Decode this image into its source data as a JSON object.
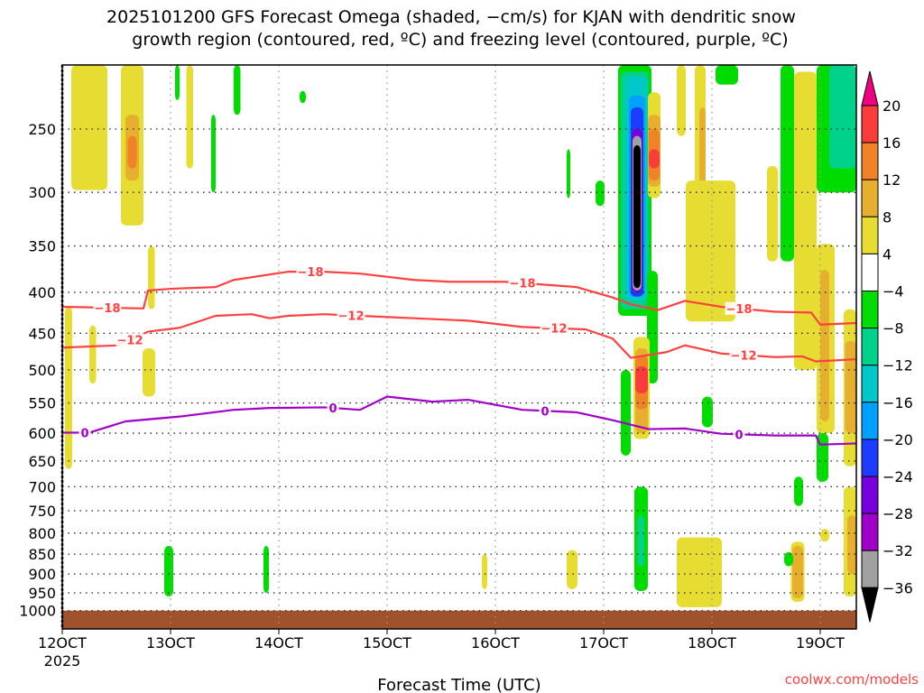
{
  "chart_data": {
    "type": "heatmap",
    "title_line1": "2025101200 GFS Forecast Omega (shaded, −cm/s) for KJAN with dendritic snow",
    "title_line2": "growth region (contoured, red, ºC) and freezing level (contoured, purple, ºC)",
    "xlabel": "Forecast Time (UTC)",
    "credit": "coolwx.com/models",
    "x_unit": "hours since 2025-10-12 00Z",
    "xlim": [
      0,
      176
    ],
    "ylim_hPa": [
      208,
      1053
    ],
    "y_scale": "log, inverted",
    "x_ticks": [
      {
        "hour": 0,
        "label": "12OCT",
        "sublabel": "2025"
      },
      {
        "hour": 24,
        "label": "13OCT"
      },
      {
        "hour": 48,
        "label": "14OCT"
      },
      {
        "hour": 72,
        "label": "15OCT"
      },
      {
        "hour": 96,
        "label": "16OCT"
      },
      {
        "hour": 120,
        "label": "17OCT"
      },
      {
        "hour": 144,
        "label": "18OCT"
      },
      {
        "hour": 168,
        "label": "19OCT"
      }
    ],
    "y_ticks": [
      250,
      300,
      350,
      400,
      450,
      500,
      550,
      600,
      650,
      700,
      750,
      800,
      850,
      900,
      950,
      1000
    ],
    "grid": true,
    "colorbar": {
      "position": "right",
      "labels": [
        "20",
        "16",
        "12",
        "8",
        "4",
        "−4",
        "−8",
        "−12",
        "−16",
        "−20",
        "−24",
        "−28",
        "−32",
        "−36"
      ],
      "bins": [
        {
          "min": 16,
          "max": 20,
          "color": "#fa3c3c"
        },
        {
          "min": 12,
          "max": 16,
          "color": "#f08228"
        },
        {
          "min": 8,
          "max": 12,
          "color": "#e6af2d"
        },
        {
          "min": 4,
          "max": 8,
          "color": "#e6dc32"
        },
        {
          "min": -4,
          "max": 4,
          "color": "#ffffff"
        },
        {
          "min": -8,
          "max": -4,
          "color": "#00dc00"
        },
        {
          "min": -12,
          "max": -8,
          "color": "#00d28c"
        },
        {
          "min": -16,
          "max": -12,
          "color": "#00c8c8"
        },
        {
          "min": -20,
          "max": -16,
          "color": "#00a0ff"
        },
        {
          "min": -24,
          "max": -20,
          "color": "#1e3cff"
        },
        {
          "min": -28,
          "max": -24,
          "color": "#7800dc"
        },
        {
          "min": -32,
          "max": -28,
          "color": "#a000c8"
        },
        {
          "min": -36,
          "max": -32,
          "color": "#a0a0a0"
        }
      ],
      "over_color": "#f00082",
      "under_color": "#000000"
    },
    "ground_color": "#a0522d",
    "ground_top_hPa": 1000,
    "shaded_regions": [
      {
        "t": [
          2,
          10
        ],
        "p": [
          208,
          298
        ],
        "v": 6
      },
      {
        "t": [
          13,
          18
        ],
        "p": [
          208,
          330
        ],
        "v": 6
      },
      {
        "t": [
          14,
          17
        ],
        "p": [
          240,
          290
        ],
        "v": 10
      },
      {
        "t": [
          14.5,
          16.5
        ],
        "p": [
          255,
          280
        ],
        "v": 14
      },
      {
        "t": [
          0.6,
          2.2
        ],
        "p": [
          417,
          665
        ],
        "v": 6
      },
      {
        "t": [
          6,
          7.5
        ],
        "p": [
          440,
          520
        ],
        "v": 6
      },
      {
        "t": [
          17.8,
          20.6
        ],
        "p": [
          470,
          540
        ],
        "v": 6
      },
      {
        "t": [
          19,
          20.5
        ],
        "p": [
          350,
          420
        ],
        "v": 6
      },
      {
        "t": [
          22.6,
          24.6
        ],
        "p": [
          830,
          960
        ],
        "v": -6
      },
      {
        "t": [
          44.6,
          45.8
        ],
        "p": [
          830,
          950
        ],
        "v": -6
      },
      {
        "t": [
          33,
          34
        ],
        "p": [
          240,
          300
        ],
        "v": -6
      },
      {
        "t": [
          25,
          26
        ],
        "p": [
          208,
          230
        ],
        "v": -6
      },
      {
        "t": [
          27.5,
          29
        ],
        "p": [
          208,
          280
        ],
        "v": 6
      },
      {
        "t": [
          38,
          39.5
        ],
        "p": [
          208,
          240
        ],
        "v": -6
      },
      {
        "t": [
          52.6,
          54
        ],
        "p": [
          224,
          232
        ],
        "v": -6
      },
      {
        "t": [
          93,
          94.2
        ],
        "p": [
          850,
          940
        ],
        "v": 6
      },
      {
        "t": [
          111.8,
          114.2
        ],
        "p": [
          840,
          940
        ],
        "v": 6
      },
      {
        "t": [
          111.8,
          112.6
        ],
        "p": [
          265,
          305
        ],
        "v": -6
      },
      {
        "t": [
          118.2,
          120.2
        ],
        "p": [
          290,
          312
        ],
        "v": -6
      },
      {
        "t": [
          123.2,
          130.6
        ],
        "p": [
          208,
          428
        ],
        "v": -6
      },
      {
        "t": [
          123.8,
          130
        ],
        "p": [
          212,
          420
        ],
        "v": -10
      },
      {
        "t": [
          124.8,
          129.6
        ],
        "p": [
          215,
          410
        ],
        "v": -14
      },
      {
        "t": [
          125.6,
          129.2
        ],
        "p": [
          227,
          405
        ],
        "v": -18
      },
      {
        "t": [
          126,
          128.8
        ],
        "p": [
          235,
          405
        ],
        "v": -22
      },
      {
        "t": [
          126.2,
          128.6
        ],
        "p": [
          250,
          400
        ],
        "v": -26
      },
      {
        "t": [
          126.4,
          128.4
        ],
        "p": [
          255,
          398
        ],
        "v": -34
      },
      {
        "t": [
          126.6,
          128.2
        ],
        "p": [
          262,
          395
        ],
        "v": -40
      },
      {
        "t": [
          129.8,
          132.6
        ],
        "p": [
          225,
          305
        ],
        "v": 6
      },
      {
        "t": [
          129.8,
          132.6
        ],
        "p": [
          240,
          295
        ],
        "v": 10
      },
      {
        "t": [
          130,
          132.4
        ],
        "p": [
          250,
          290
        ],
        "v": 14
      },
      {
        "t": [
          130,
          132.4
        ],
        "p": [
          265,
          280
        ],
        "v": 18
      },
      {
        "t": [
          129.6,
          132
        ],
        "p": [
          376,
          520
        ],
        "v": -6
      },
      {
        "t": [
          126.6,
          130.2
        ],
        "p": [
          455,
          610
        ],
        "v": 6
      },
      {
        "t": [
          127,
          129.8
        ],
        "p": [
          470,
          600
        ],
        "v": 10
      },
      {
        "t": [
          127,
          129.8
        ],
        "p": [
          480,
          560
        ],
        "v": 14
      },
      {
        "t": [
          127,
          129.8
        ],
        "p": [
          495,
          535
        ],
        "v": 18
      },
      {
        "t": [
          123.8,
          126
        ],
        "p": [
          500,
          640
        ],
        "v": -6
      },
      {
        "t": [
          126.8,
          129.8
        ],
        "p": [
          700,
          945
        ],
        "v": -6
      },
      {
        "t": [
          127.5,
          129
        ],
        "p": [
          760,
          880
        ],
        "v": -10
      },
      {
        "t": [
          136.2,
          138.2
        ],
        "p": [
          208,
          255
        ],
        "v": 6
      },
      {
        "t": [
          140.2,
          142.6
        ],
        "p": [
          208,
          298
        ],
        "v": 6
      },
      {
        "t": [
          141.2,
          142.6
        ],
        "p": [
          235,
          295
        ],
        "v": 10
      },
      {
        "t": [
          138.2,
          149.2
        ],
        "p": [
          290,
          435
        ],
        "v": 6
      },
      {
        "t": [
          141.8,
          144.2
        ],
        "p": [
          540,
          590
        ],
        "v": -6
      },
      {
        "t": [
          136.2,
          146.2
        ],
        "p": [
          810,
          990
        ],
        "v": 6
      },
      {
        "t": [
          144.8,
          149.8
        ],
        "p": [
          208,
          220
        ],
        "v": -6
      },
      {
        "t": [
          156.2,
          158.6
        ],
        "p": [
          278,
          366
        ],
        "v": 6
      },
      {
        "t": [
          159.2,
          162.2
        ],
        "p": [
          208,
          366
        ],
        "v": -6
      },
      {
        "t": [
          162.2,
          167.2
        ],
        "p": [
          212,
          500
        ],
        "v": 6
      },
      {
        "t": [
          167.2,
          176
        ],
        "p": [
          208,
          300
        ],
        "v": -6
      },
      {
        "t": [
          170,
          176
        ],
        "p": [
          208,
          280
        ],
        "v": -10
      },
      {
        "t": [
          167.2,
          171.2
        ],
        "p": [
          348,
          600
        ],
        "v": 6
      },
      {
        "t": [
          168,
          170
        ],
        "p": [
          375,
          580
        ],
        "v": 10
      },
      {
        "t": [
          173.2,
          176
        ],
        "p": [
          420,
          660
        ],
        "v": 6
      },
      {
        "t": [
          173.5,
          176
        ],
        "p": [
          460,
          600
        ],
        "v": 10
      },
      {
        "t": [
          173.2,
          176
        ],
        "p": [
          700,
          960
        ],
        "v": 6
      },
      {
        "t": [
          174,
          176
        ],
        "p": [
          760,
          900
        ],
        "v": 10
      },
      {
        "t": [
          161.5,
          164.5
        ],
        "p": [
          820,
          975
        ],
        "v": 6
      },
      {
        "t": [
          161.8,
          164.2
        ],
        "p": [
          830,
          965
        ],
        "v": 10
      },
      {
        "t": [
          167.2,
          169.8
        ],
        "p": [
          600,
          690
        ],
        "v": -6
      },
      {
        "t": [
          162.2,
          164.2
        ],
        "p": [
          680,
          740
        ],
        "v": -6
      },
      {
        "t": [
          160,
          162
        ],
        "p": [
          845,
          880
        ],
        "v": -6
      },
      {
        "t": [
          168,
          170
        ],
        "p": [
          790,
          820
        ],
        "v": 6
      }
    ],
    "contours": [
      {
        "name": "dgz-minus18",
        "label": "−18",
        "color": "#ff4040",
        "points": [
          [
            0,
            417
          ],
          [
            18,
            419
          ],
          [
            19,
            398
          ],
          [
            24,
            396
          ],
          [
            34,
            394
          ],
          [
            38,
            386
          ],
          [
            46,
            380
          ],
          [
            50,
            377
          ],
          [
            58,
            377
          ],
          [
            66,
            379
          ],
          [
            78,
            386
          ],
          [
            86,
            388
          ],
          [
            98,
            388
          ],
          [
            114,
            394
          ],
          [
            122,
            406
          ],
          [
            126,
            414
          ],
          [
            132,
            421
          ],
          [
            138,
            410
          ],
          [
            146,
            417
          ],
          [
            158,
            423
          ],
          [
            166,
            424
          ],
          [
            168,
            439
          ],
          [
            176,
            437
          ]
        ],
        "label_hours": [
          10,
          55,
          102,
          150
        ]
      },
      {
        "name": "dgz-minus12",
        "label": "−12",
        "color": "#ff4040",
        "points": [
          [
            0,
            469
          ],
          [
            12,
            466
          ],
          [
            19,
            448
          ],
          [
            26,
            443
          ],
          [
            34,
            428
          ],
          [
            42,
            426
          ],
          [
            46,
            431
          ],
          [
            50,
            428
          ],
          [
            58,
            426
          ],
          [
            66,
            428
          ],
          [
            78,
            431
          ],
          [
            90,
            434
          ],
          [
            102,
            442
          ],
          [
            116,
            445
          ],
          [
            122,
            457
          ],
          [
            126,
            483
          ],
          [
            134,
            475
          ],
          [
            138,
            466
          ],
          [
            146,
            477
          ],
          [
            158,
            482
          ],
          [
            164,
            481
          ],
          [
            167,
            488
          ],
          [
            176,
            485
          ]
        ],
        "label_hours": [
          15,
          64,
          109,
          151
        ]
      },
      {
        "name": "freezing-level-0",
        "label": "0",
        "color": "#a000c8",
        "points": [
          [
            0,
            599
          ],
          [
            6,
            599
          ],
          [
            14,
            580
          ],
          [
            26,
            572
          ],
          [
            38,
            561
          ],
          [
            46,
            558
          ],
          [
            58,
            557
          ],
          [
            66,
            561
          ],
          [
            72,
            540
          ],
          [
            82,
            548
          ],
          [
            90,
            545
          ],
          [
            102,
            561
          ],
          [
            114,
            565
          ],
          [
            122,
            578
          ],
          [
            130,
            593
          ],
          [
            138,
            592
          ],
          [
            146,
            601
          ],
          [
            158,
            604
          ],
          [
            167,
            604
          ],
          [
            168,
            620
          ],
          [
            176,
            618
          ]
        ],
        "label_hours": [
          5,
          60,
          107,
          150
        ]
      }
    ]
  }
}
